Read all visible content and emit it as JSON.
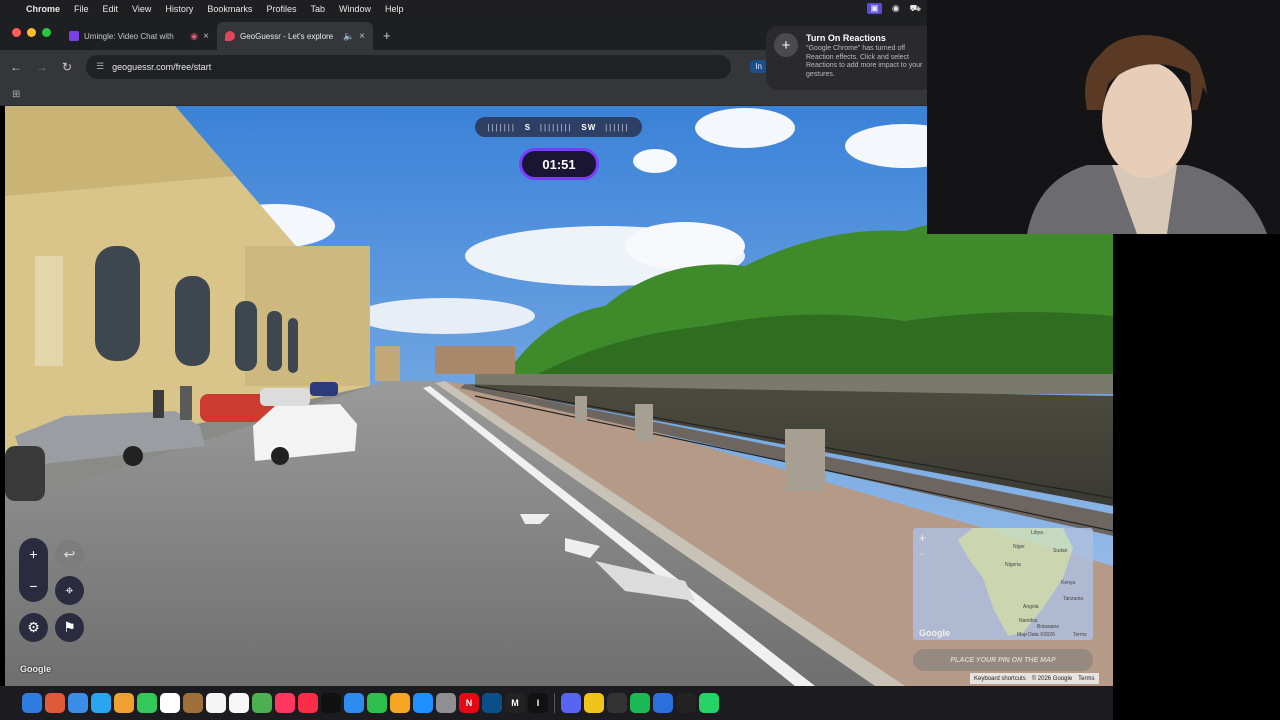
{
  "menubar": {
    "app_name": "Chrome",
    "items": [
      "File",
      "Edit",
      "View",
      "History",
      "Bookmarks",
      "Profiles",
      "Tab",
      "Window",
      "Help"
    ]
  },
  "tabs": [
    {
      "title": "Umingle: Video Chat with",
      "favicon_color": "#7b3fe4",
      "active": false
    },
    {
      "title": "GeoGuessr - Let's explore",
      "favicon_color": "#e0455a",
      "active": true
    }
  ],
  "toolbar": {
    "url": "geoguessr.com/free/start",
    "extension_label": "In"
  },
  "game": {
    "compass": {
      "left_tick": "|||||||",
      "s": "S",
      "mid_tick": "||||||||",
      "sw": "SW",
      "right_tick": "||||||"
    },
    "timer": "01:51",
    "guess_button": "PLACE YOUR PIN ON THE MAP",
    "google_logo": "Google",
    "minimap_labels": [
      "Libya",
      "Niger",
      "Sudan",
      "Nigeria",
      "Kenya",
      "Angola",
      "Namibia",
      "Botswana",
      "Tanzania"
    ],
    "map_footer": {
      "keyboard": "Keyboard shortcuts",
      "data": "Map data ©2026",
      "copyright": "© 2026 Google",
      "terms": "Terms"
    },
    "minimap_footer": {
      "google": "Google",
      "data": "Map Data ©2026",
      "terms": "Terms"
    }
  },
  "notification": {
    "title": "Turn On Reactions",
    "body": "\"Google Chrome\" has turned off Reaction effects. Click  and select Reactions to add more impact to your gestures."
  },
  "dock": {
    "apps": [
      {
        "name": "finder",
        "color": "#2f7de1"
      },
      {
        "name": "launchpad",
        "color": "#e05a3a"
      },
      {
        "name": "mail",
        "color": "#3b8de8"
      },
      {
        "name": "safari",
        "color": "#2aa6f0"
      },
      {
        "name": "photos",
        "color": "#f0a030"
      },
      {
        "name": "facetime",
        "color": "#34c759"
      },
      {
        "name": "calendar",
        "color": "#ffffff"
      },
      {
        "name": "notes-brown",
        "color": "#a0703a"
      },
      {
        "name": "reminders",
        "color": "#f5f5f5"
      },
      {
        "name": "freeform",
        "color": "#f7f7f7"
      },
      {
        "name": "maps",
        "color": "#4caf50"
      },
      {
        "name": "news",
        "color": "#ff375f"
      },
      {
        "name": "music",
        "color": "#fa2d48"
      },
      {
        "name": "tv",
        "color": "#111111"
      },
      {
        "name": "keynote",
        "color": "#2d8cf0"
      },
      {
        "name": "numbers",
        "color": "#2fbf4f"
      },
      {
        "name": "pages",
        "color": "#f6a623"
      },
      {
        "name": "app-store",
        "color": "#1e90ff"
      },
      {
        "name": "settings",
        "color": "#8e8e93"
      },
      {
        "name": "netflix",
        "color": "#e50914"
      },
      {
        "name": "word-app",
        "color": "#0b4f8a"
      },
      {
        "name": "medium",
        "color": "#222222"
      },
      {
        "name": "cursor",
        "color": "#111111"
      }
    ],
    "apps2": [
      {
        "name": "discord",
        "color": "#5865f2"
      },
      {
        "name": "chrome",
        "color": "#f0c419"
      },
      {
        "name": "piano",
        "color": "#333333"
      },
      {
        "name": "spotify",
        "color": "#1db954"
      },
      {
        "name": "quicktime",
        "color": "#2a6fdb"
      },
      {
        "name": "activity-monitor",
        "color": "#222222"
      },
      {
        "name": "whatsapp",
        "color": "#25d366"
      }
    ],
    "labels": {
      "medium": "M",
      "cursor": "I",
      "netflix": "N"
    }
  }
}
